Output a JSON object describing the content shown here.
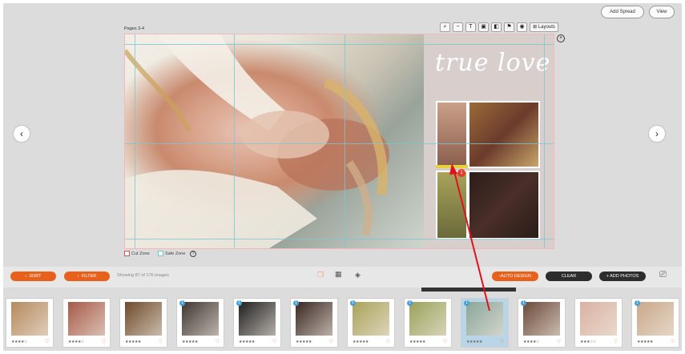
{
  "header": {
    "add_spread": "Add Spread",
    "view": "View"
  },
  "spread": {
    "pages_label": "Pages 3-4",
    "title_text": "true love",
    "tools": [
      "magnifier-icon",
      "minus-line-icon",
      "text-icon",
      "layer-front-icon",
      "layer-back-icon",
      "flag-icon",
      "eye-icon"
    ],
    "layouts_label": "Layouts",
    "badge_count": "1"
  },
  "zones": {
    "cut": "Cut Zone",
    "safe": "Safe Zone",
    "help": "?"
  },
  "toolbar": {
    "sort": "SORT",
    "filter": "FILTER",
    "showing": "Showing 87 of 176 images",
    "auto_design": "AUTO DESIGN",
    "clear": "CLEAR",
    "add_photos": "+ ADD PHOTOS"
  },
  "thumbnails": [
    {
      "badge": "",
      "stars": "★★★★☆",
      "selected": false,
      "color": "#b58a5e"
    },
    {
      "badge": "",
      "stars": "★★★★☆",
      "selected": false,
      "color": "#a65a48"
    },
    {
      "badge": "",
      "stars": "★★★★★",
      "selected": false,
      "color": "#6e4b2c"
    },
    {
      "badge": "1",
      "stars": "★★★★★",
      "selected": false,
      "color": "#3e3630"
    },
    {
      "badge": "1",
      "stars": "★★★★★",
      "selected": false,
      "color": "#1f1f1f"
    },
    {
      "badge": "1",
      "stars": "★★★★★",
      "selected": false,
      "color": "#3a2722"
    },
    {
      "badge": "1",
      "stars": "★★★★★",
      "selected": false,
      "color": "#a9a35c"
    },
    {
      "badge": "1",
      "stars": "★★★★★",
      "selected": false,
      "color": "#9aa25a"
    },
    {
      "badge": "1",
      "stars": "★★★★★",
      "selected": true,
      "color": "#8aa69a"
    },
    {
      "badge": "1",
      "stars": "★★★★☆",
      "selected": false,
      "color": "#6b4a3a"
    },
    {
      "badge": "",
      "stars": "★★★☆☆",
      "selected": false,
      "color": "#d9b2a2"
    },
    {
      "badge": "1",
      "stars": "★★★★★",
      "selected": false,
      "color": "#c9a98a"
    }
  ],
  "heart": "♡",
  "colors": {
    "accent": "#e8611c",
    "dark": "#2d2d2d",
    "guide": "#79c7d4",
    "arrow": "#e0121a"
  }
}
